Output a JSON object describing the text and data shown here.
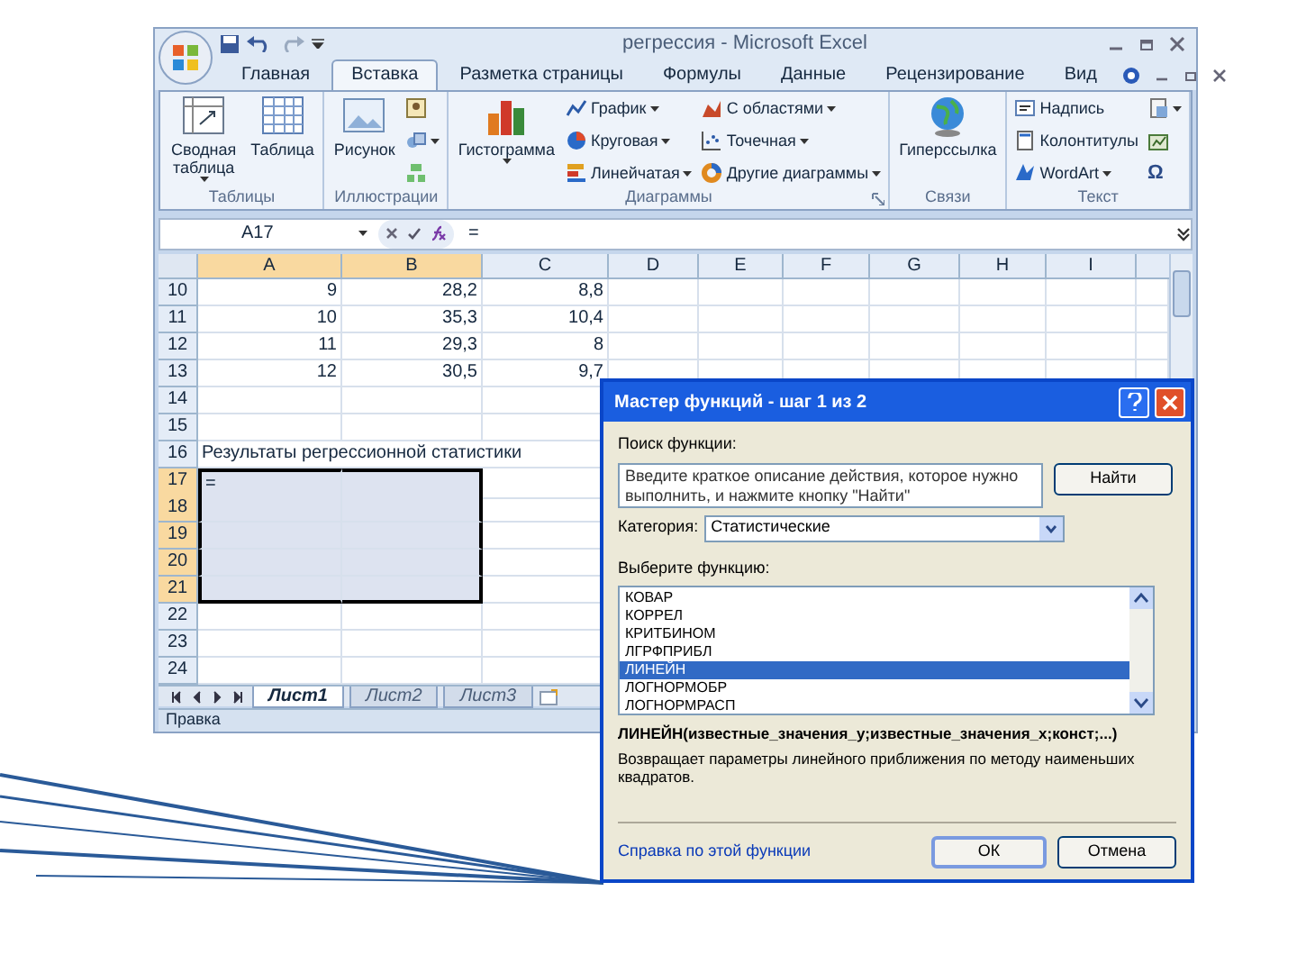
{
  "window": {
    "title": "регрессия - Microsoft Excel"
  },
  "tabs": [
    {
      "label": "Главная",
      "selected": false
    },
    {
      "label": "Вставка",
      "selected": true
    },
    {
      "label": "Разметка страницы",
      "selected": false
    },
    {
      "label": "Формулы",
      "selected": false
    },
    {
      "label": "Данные",
      "selected": false
    },
    {
      "label": "Рецензирование",
      "selected": false
    },
    {
      "label": "Вид",
      "selected": false
    }
  ],
  "ribbon": [
    {
      "label": "Таблицы",
      "items": [
        {
          "kind": "large",
          "label": "Сводная таблица",
          "dropdown": true
        },
        {
          "kind": "large",
          "label": "Таблица",
          "dropdown": false
        }
      ]
    },
    {
      "label": "Иллюстрации",
      "items": [
        {
          "kind": "large",
          "label": "Рисунок",
          "dropdown": false
        },
        {
          "kind": "icon",
          "dropdown": false
        },
        {
          "kind": "icon",
          "dropdown": true
        },
        {
          "kind": "icon",
          "dropdown": false
        }
      ]
    },
    {
      "label": "Диаграммы",
      "items": [
        {
          "kind": "large",
          "label": "Гистограмма",
          "dropdown": true
        },
        {
          "kind": "small",
          "label": "График",
          "dropdown": true
        },
        {
          "kind": "small",
          "label": "Круговая",
          "dropdown": true
        },
        {
          "kind": "small",
          "label": "Линейчатая",
          "dropdown": true
        },
        {
          "kind": "small",
          "label": "С областями",
          "dropdown": true
        },
        {
          "kind": "small",
          "label": "Точечная",
          "dropdown": true
        },
        {
          "kind": "small",
          "label": "Другие диаграммы",
          "dropdown": true
        }
      ]
    },
    {
      "label": "Связи",
      "items": [
        {
          "kind": "large",
          "label": "Гиперссылка",
          "dropdown": false
        }
      ]
    },
    {
      "label": "Текст",
      "items": [
        {
          "kind": "small",
          "label": "Надпись",
          "dropdown": false
        },
        {
          "kind": "small",
          "label": "Колонтитулы",
          "dropdown": false
        },
        {
          "kind": "small",
          "label": "WordArt",
          "dropdown": true
        },
        {
          "kind": "icon",
          "dropdown": true
        },
        {
          "kind": "icon",
          "dropdown": false
        },
        {
          "kind": "symbol",
          "label": "Ω",
          "dropdown": false
        }
      ]
    }
  ],
  "formula_bar": {
    "name_box": "A17",
    "formula": "="
  },
  "columns": [
    {
      "label": "A",
      "selected": true
    },
    {
      "label": "B",
      "selected": true
    },
    {
      "label": "C",
      "selected": false
    },
    {
      "label": "D",
      "selected": false
    },
    {
      "label": "E",
      "selected": false
    },
    {
      "label": "F",
      "selected": false
    },
    {
      "label": "G",
      "selected": false
    },
    {
      "label": "H",
      "selected": false
    },
    {
      "label": "I",
      "selected": false
    }
  ],
  "rows": [
    {
      "header": "10",
      "selected": false,
      "cells": [
        "9",
        "28,2",
        "8,8"
      ]
    },
    {
      "header": "11",
      "selected": false,
      "cells": [
        "10",
        "35,3",
        "10,4"
      ]
    },
    {
      "header": "12",
      "selected": false,
      "cells": [
        "11",
        "29,3",
        "8"
      ]
    },
    {
      "header": "13",
      "selected": false,
      "cells": [
        "12",
        "30,5",
        "9,7"
      ]
    },
    {
      "header": "14",
      "selected": false
    },
    {
      "header": "15",
      "selected": false
    },
    {
      "header": "16",
      "selected": false,
      "cells": [
        "Результаты регрессионной статистики"
      ]
    },
    {
      "header": "17",
      "selected": true,
      "cells": [
        "="
      ]
    },
    {
      "header": "18",
      "selected": true
    },
    {
      "header": "19",
      "selected": true
    },
    {
      "header": "20",
      "selected": true
    },
    {
      "header": "21",
      "selected": true
    },
    {
      "header": "22",
      "selected": false
    },
    {
      "header": "23",
      "selected": false
    },
    {
      "header": "24",
      "selected": false
    }
  ],
  "sheet_tabs": [
    {
      "label": "Лист1",
      "selected": true
    },
    {
      "label": "Лист2",
      "selected": false
    },
    {
      "label": "Лист3",
      "selected": false
    }
  ],
  "status_bar": "Правка",
  "dialog": {
    "title": "Мастер функций - шаг 1 из 2",
    "search_label": "Поиск функции:",
    "search_text": "Введите краткое описание действия, которое нужно выполнить, и нажмите кнопку \"Найти\"",
    "find_button": "Найти",
    "category_label": "Категория:",
    "category": "Статистические",
    "list_label": "Выберите функцию:",
    "functions": [
      {
        "label": "КОВАР",
        "selected": false
      },
      {
        "label": "КОРРЕЛ",
        "selected": false
      },
      {
        "label": "КРИТБИНОМ",
        "selected": false
      },
      {
        "label": "ЛГРФПРИБЛ",
        "selected": false
      },
      {
        "label": "ЛИНЕЙН",
        "selected": true
      },
      {
        "label": "ЛОГНОРМОБР",
        "selected": false
      },
      {
        "label": "ЛОГНОРМРАСП",
        "selected": false
      }
    ],
    "signature": "ЛИНЕЙН(известные_значения_y;известные_значения_x;конст;...)",
    "description": "Возвращает параметры линейного приближения по методу наименьших квадратов.",
    "help_link": "Справка по этой функции",
    "ok_button": "ОК",
    "cancel_button": "Отмена"
  }
}
